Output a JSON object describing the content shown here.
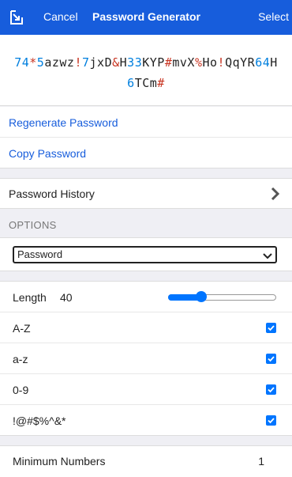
{
  "header": {
    "cancel_label": "Cancel",
    "title": "Password Generator",
    "select_label": "Select"
  },
  "password": {
    "value": "74*5azwz!7jxD&H33KYP#mvX%Ho!QqYR64H6TCm#"
  },
  "actions": {
    "regenerate_label": "Regenerate Password",
    "copy_label": "Copy Password"
  },
  "history": {
    "label": "Password History"
  },
  "options": {
    "section_title": "OPTIONS",
    "type_selected": "Password",
    "length_label": "Length",
    "length_value": "40",
    "length_slider_fraction": 0.31,
    "uppercase_label": "A-Z",
    "uppercase_checked": true,
    "lowercase_label": "a-z",
    "lowercase_checked": true,
    "numbers_label": "0-9",
    "numbers_checked": true,
    "special_label": "!@#$%^&*",
    "special_checked": true,
    "min_numbers_label": "Minimum Numbers",
    "min_numbers_value": "1"
  },
  "colors": {
    "header_bg": "#175ddc",
    "accent": "#175ddc",
    "digit_color": "#007fde",
    "symbol_color": "#c83522",
    "checkbox": "#0075ff"
  }
}
